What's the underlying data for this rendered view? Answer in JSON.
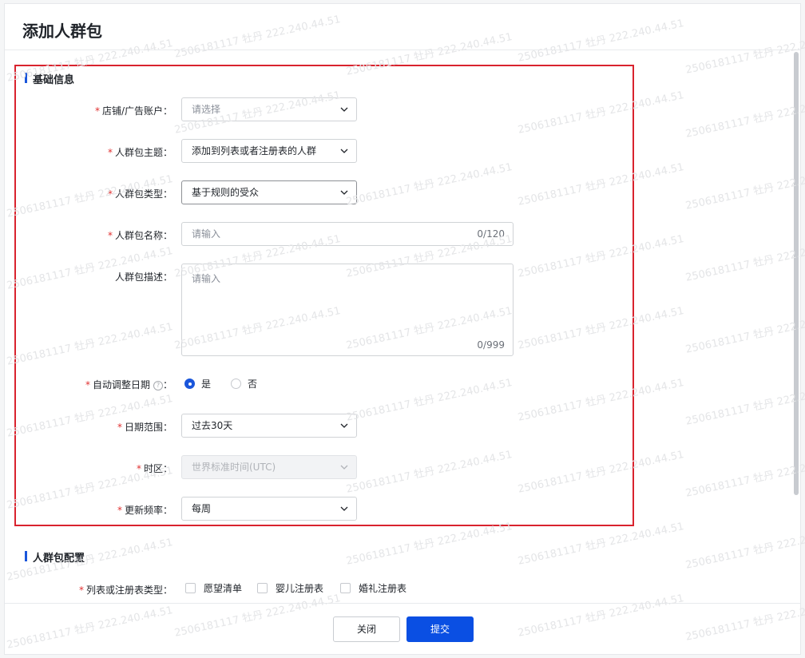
{
  "dialog": {
    "title": "添加人群包"
  },
  "sections": {
    "basic": "基础信息",
    "config": "人群包配置"
  },
  "fields": {
    "store_account": {
      "label": "店铺/广告账户：",
      "placeholder": "请选择"
    },
    "theme": {
      "label": "人群包主题：",
      "value": "添加到列表或者注册表的人群"
    },
    "type": {
      "label": "人群包类型：",
      "value": "基于规则的受众"
    },
    "name": {
      "label": "人群包名称：",
      "placeholder": "请输入",
      "counter": "0/120"
    },
    "desc": {
      "label": "人群包描述：",
      "placeholder": "请输入",
      "counter": "0/999"
    },
    "auto_adjust": {
      "label": "自动调整日期",
      "help": "?",
      "colon": "：",
      "yes": "是",
      "no": "否",
      "selected": "是"
    },
    "date_range": {
      "label": "日期范围：",
      "value": "过去30天"
    },
    "timezone": {
      "label": "时区：",
      "value": "世界标准时间(UTC)"
    },
    "frequency": {
      "label": "更新频率：",
      "value": "每周"
    },
    "list_type": {
      "label": "列表或注册表类型：",
      "options": [
        "愿望清单",
        "婴儿注册表",
        "婚礼注册表"
      ]
    }
  },
  "footer": {
    "close": "关闭",
    "submit": "提交"
  },
  "watermark": "2506181117 牡丹 222.240.44.51",
  "colors": {
    "accent": "#0a4fe3",
    "required": "#e03131",
    "highlight_border": "#d9232e"
  },
  "icons": {
    "chevron": "chevron-down-icon",
    "help": "help-circle-icon"
  }
}
